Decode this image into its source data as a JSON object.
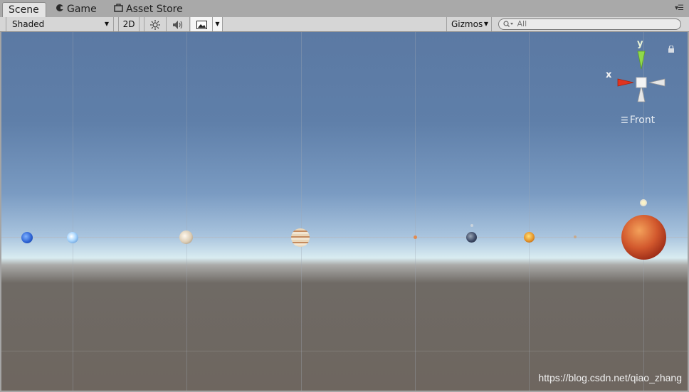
{
  "tabs": [
    {
      "label": "Scene",
      "icon": "scene-icon",
      "active": true
    },
    {
      "label": "Game",
      "icon": "game-icon",
      "active": false
    },
    {
      "label": "Asset Store",
      "icon": "store-icon",
      "active": false
    }
  ],
  "toolbar": {
    "shading_mode": "Shaded",
    "mode_2d": "2D",
    "gizmos_label": "Gizmos",
    "search_placeholder": "All"
  },
  "scene": {
    "view_label": "Front",
    "axis_x_label": "x",
    "axis_y_label": "y",
    "watermark": "https://blog.csdn.net/qiao_zhang"
  },
  "colors": {
    "x_axis": "#e0341f",
    "y_axis": "#8fd94a",
    "sky_top": "#5b79a3",
    "ground": "#6e665f"
  }
}
